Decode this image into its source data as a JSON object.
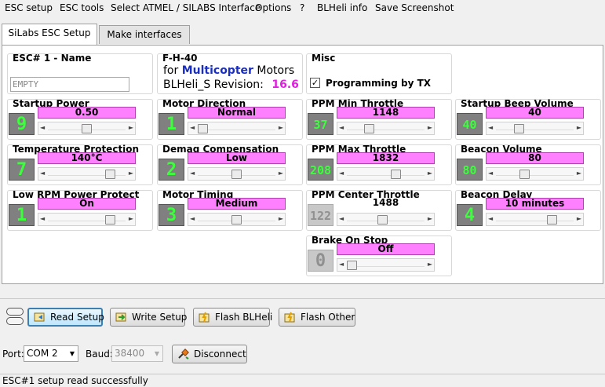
{
  "menu": [
    "ESC setup",
    "ESC tools",
    "Select ATMEL / SILABS Interface",
    "Options",
    "?",
    "BLHeli info",
    "Save Screenshot"
  ],
  "tabs": [
    "SiLabs ESC Setup",
    "Make interfaces"
  ],
  "esc_name": {
    "title": "ESC# 1 - Name",
    "value": "EMPTY"
  },
  "firmware": {
    "title": "F-H-40",
    "for_label": "for",
    "type": "Multicopter",
    "motors_label": "Motors",
    "revision_label": "BLHeli_S Revision:",
    "revision": "16.6"
  },
  "misc": {
    "title": "Misc",
    "programming_by_tx": "Programming by TX",
    "programming_checked": true
  },
  "settings": {
    "startup_power": {
      "title": "Startup Power",
      "num": "9",
      "value": "0.50",
      "level": 0.5
    },
    "motor_direction": {
      "title": "Motor Direction",
      "num": "1",
      "value": "Normal",
      "level": 0.0
    },
    "ppm_min": {
      "title": "PPM Min Throttle",
      "num": "37",
      "value": "1148",
      "level": 0.25
    },
    "startup_beep": {
      "title": "Startup Beep Volume",
      "num": "40",
      "value": "40",
      "level": 0.27
    },
    "temp_protection": {
      "title": "Temperature Protection",
      "num": "7",
      "value": "140°C",
      "level": 0.85
    },
    "demag": {
      "title": "Demag Compensation",
      "num": "2",
      "value": "Low",
      "level": 0.5
    },
    "ppm_max": {
      "title": "PPM Max Throttle",
      "num": "208",
      "value": "1832",
      "level": 0.65
    },
    "beacon_volume": {
      "title": "Beacon Volume",
      "num": "80",
      "value": "80",
      "level": 0.35
    },
    "low_rpm": {
      "title": "Low RPM Power Protect",
      "num": "1",
      "value": "On",
      "level": 0.85
    },
    "motor_timing": {
      "title": "Motor Timing",
      "num": "3",
      "value": "Medium",
      "level": 0.5
    },
    "ppm_center": {
      "title": "PPM Center Throttle",
      "num": "122",
      "value": "1488",
      "level": 0.45
    },
    "beacon_delay": {
      "title": "Beacon Delay",
      "num": "4",
      "value": "10 minutes",
      "level": 0.75
    },
    "brake_on_stop": {
      "title": "Brake On Stop",
      "num": "0",
      "value": "Off",
      "level": 0.0
    }
  },
  "buttons": {
    "read": "Read Setup",
    "write": "Write Setup",
    "flash_blheli": "Flash BLHeli",
    "flash_other": "Flash Other",
    "disconnect": "Disconnect"
  },
  "port": {
    "label": "Port:",
    "value": "COM 2"
  },
  "baud": {
    "label": "Baud:",
    "value": "38400"
  },
  "status": "ESC#1 setup read successfully"
}
